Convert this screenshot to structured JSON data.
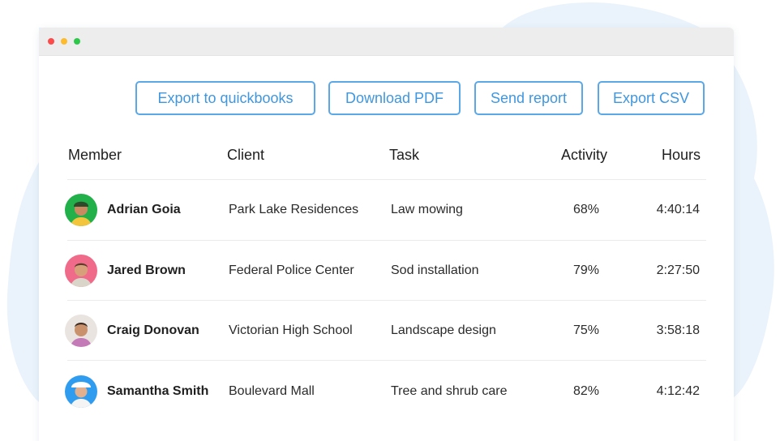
{
  "window": {
    "controls": [
      "close",
      "minimize",
      "maximize"
    ]
  },
  "toolbar": {
    "export_quickbooks": "Export to quickbooks",
    "download_pdf": "Download PDF",
    "send_report": "Send report",
    "export_csv": "Export CSV"
  },
  "table": {
    "headers": {
      "member": "Member",
      "client": "Client",
      "task": "Task",
      "activity": "Activity",
      "hours": "Hours"
    },
    "rows": [
      {
        "member": "Adrian Goia",
        "client": "Park Lake Residences",
        "task": "Law mowing",
        "activity": "68%",
        "hours": "4:40:14",
        "avatar_bg": "#22b04b"
      },
      {
        "member": "Jared Brown",
        "client": "Federal Police Center",
        "task": "Sod installation",
        "activity": "79%",
        "hours": "2:27:50",
        "avatar_bg": "#f06a8a"
      },
      {
        "member": "Craig Donovan",
        "client": "Victorian High School",
        "task": "Landscape design",
        "activity": "75%",
        "hours": "3:58:18",
        "avatar_bg": "#e9e4df"
      },
      {
        "member": "Samantha Smith",
        "client": "Boulevard Mall",
        "task": "Tree and shrub care",
        "activity": "82%",
        "hours": "4:12:42",
        "avatar_bg": "#2f9cf0"
      }
    ]
  },
  "colors": {
    "accent": "#3f97e0",
    "button_border": "#5aa8e8",
    "background_blob": "#eaf3fb"
  }
}
